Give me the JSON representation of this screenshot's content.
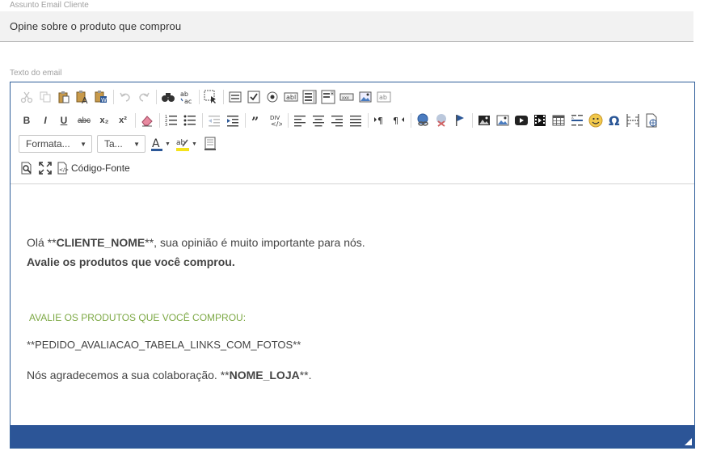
{
  "subject": {
    "label": "Assunto Email Cliente",
    "value": "Opine sobre o produto que comprou"
  },
  "body": {
    "label": "Texto do email"
  },
  "toolbar": {
    "row1": [
      "cut-icon",
      "copy-icon",
      "paste-icon",
      "paste-text-icon",
      "paste-word-icon",
      "undo-icon",
      "redo-icon",
      "find-icon",
      "replace-icon",
      "select-all-icon",
      "form-icon",
      "checkbox-icon",
      "radio-icon",
      "textfield-icon",
      "textarea-icon",
      "select-icon",
      "button-icon",
      "image-button-icon",
      "hidden-field-icon"
    ],
    "bold": "B",
    "italic": "I",
    "underline": "U",
    "strike": "abc",
    "subscript": "x₂",
    "superscript": "x²",
    "format_label": "Formata...",
    "size_label": "Ta...",
    "source_label": "Código-Fonte"
  },
  "content": {
    "line1_pre": "Olá **",
    "line1_bold": "CLIENTE_NOME",
    "line1_post": "**, sua opinião é muito importante para nós.",
    "line2": "Avalie os produtos que você comprou.",
    "line3": "AVALIE OS PRODUTOS QUE VOCÊ COMPROU:",
    "line4": "**PEDIDO_AVALIACAO_TABELA_LINKS_COM_FOTOS**",
    "line5_pre": "Nós agradecemos a sua colaboração. **",
    "line5_bold": "NOME_LOJA",
    "line5_post": "**."
  },
  "colors": {
    "editor_border": "#2e5d99",
    "statusbar": "#2c5597",
    "green_text": "#7ca844",
    "subject_bg": "#f2f2f2"
  }
}
